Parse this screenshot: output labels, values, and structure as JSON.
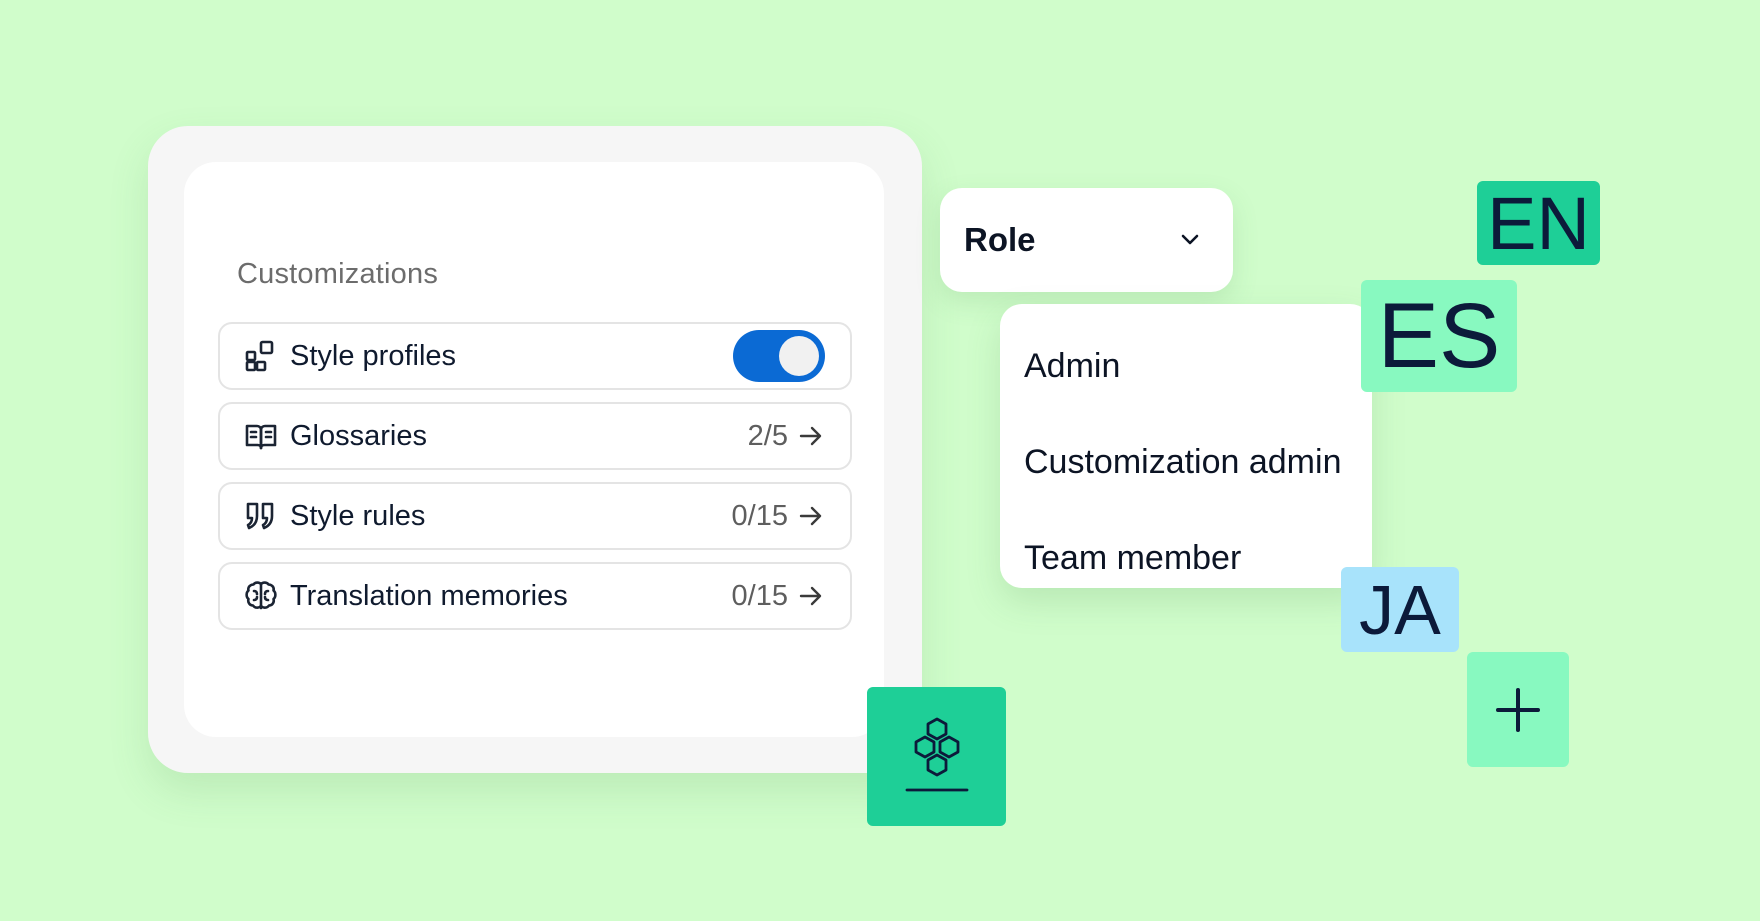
{
  "customizations": {
    "title": "Customizations",
    "rows": [
      {
        "label": "Style profiles",
        "icon": "style-profiles-icon",
        "toggle": "on"
      },
      {
        "label": "Glossaries",
        "icon": "book-icon",
        "count": "2/5"
      },
      {
        "label": "Style rules",
        "icon": "quote-icon",
        "count": "0/15"
      },
      {
        "label": "Translation memories",
        "icon": "brain-icon",
        "count": "0/15"
      }
    ]
  },
  "role": {
    "label": "Role",
    "options": [
      "Admin",
      "Customization admin",
      "Team member"
    ]
  },
  "languages": [
    "EN",
    "ES",
    "JA"
  ],
  "colors": {
    "background": "#d0fdcb",
    "accent_blue": "#0b6ad4",
    "teal": "#1ecf97",
    "mint": "#88f9c0",
    "sky": "#a8e3fb",
    "ink": "#0c1a3a"
  }
}
